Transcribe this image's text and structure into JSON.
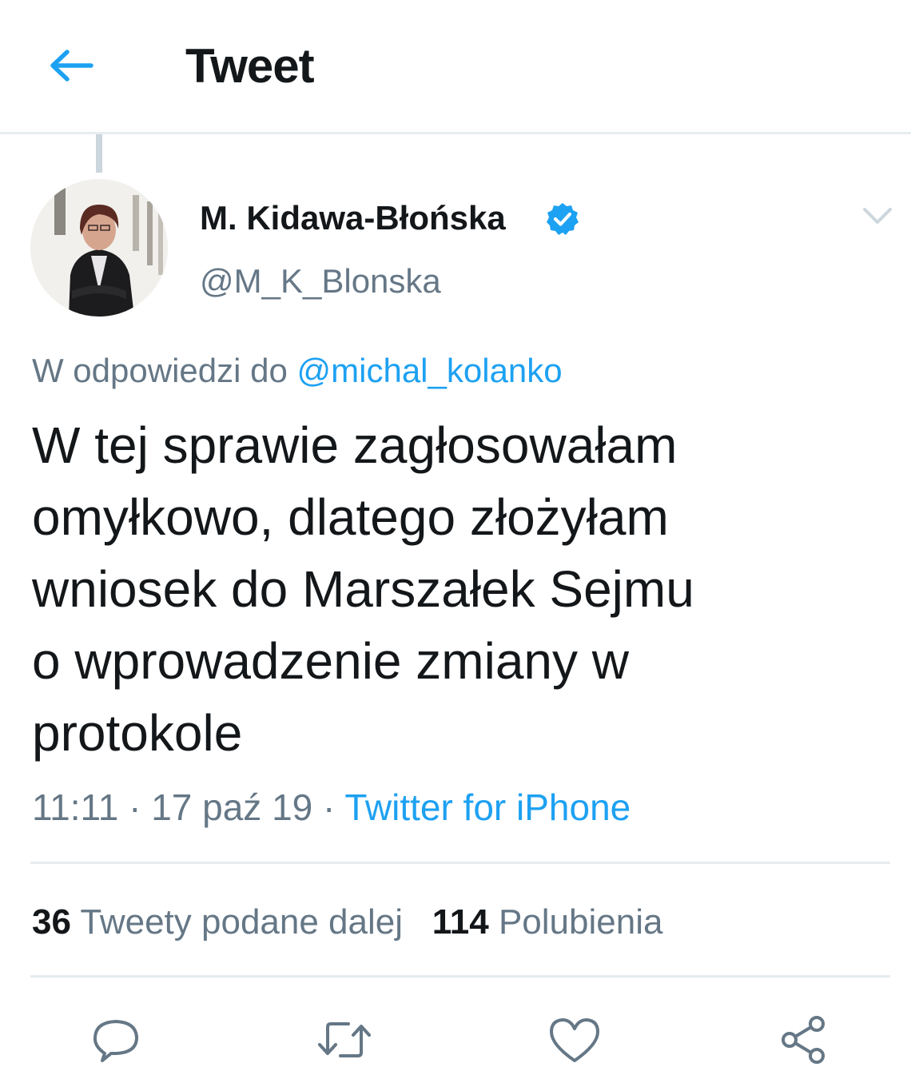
{
  "header": {
    "back_icon": "arrow-left-icon",
    "title": "Tweet"
  },
  "tweet": {
    "author": {
      "name": "M. Kidawa-Błońska",
      "handle": "@M_K_Blonska",
      "verified": true,
      "verified_icon": "verified-badge-icon"
    },
    "menu_icon": "chevron-down-icon",
    "reply_prefix": "W odpowiedzi do",
    "reply_to": "@michal_kolanko",
    "text": "W tej sprawie zagłosowałam\nomyłkowo, dlatego złożyłam\nwniosek do Marszałek Sejmu\no wprowadzenie zmiany w\nprotokole",
    "time": "11:11",
    "separator": "·",
    "date": "17 paź 19",
    "source": "Twitter for iPhone",
    "stats": {
      "retweets_count": "36",
      "retweets_label": "Tweety podane dalej",
      "likes_count": "114",
      "likes_label": "Polubienia"
    },
    "actions": {
      "reply_icon": "reply-icon",
      "retweet_icon": "retweet-icon",
      "like_icon": "heart-icon",
      "share_icon": "share-icon"
    }
  },
  "colors": {
    "accent": "#1da1f2",
    "text": "#14171a",
    "secondary": "#657786",
    "divider": "#e6ecf0"
  }
}
